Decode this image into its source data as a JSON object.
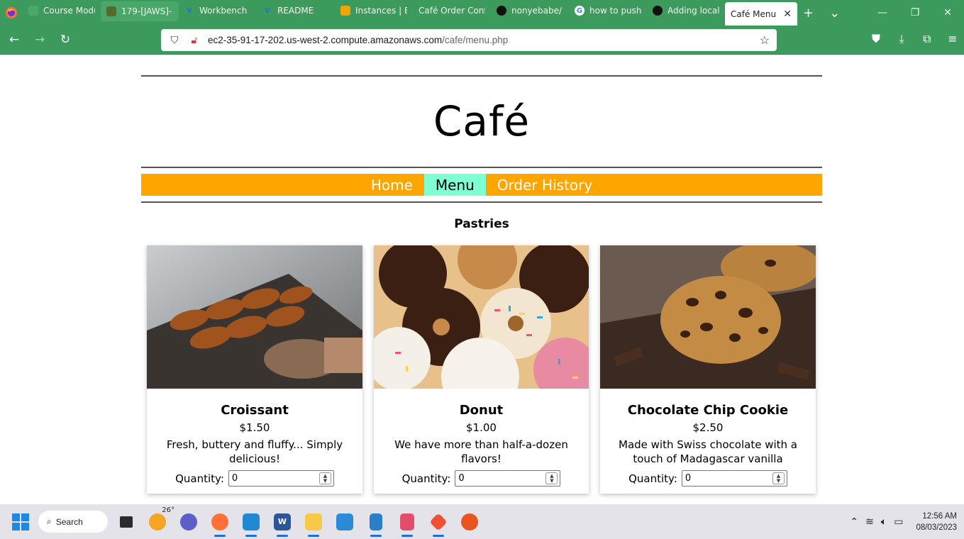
{
  "browser": {
    "tabs": [
      {
        "title": "Course Modules",
        "icon": "canvas-icon",
        "color": "#4aa76a"
      },
      {
        "title": "179-[JAWS]-",
        "icon": "vocareum-icon",
        "color": "#4aa76a"
      },
      {
        "title": "Workbench",
        "icon": "vocareum-v-icon",
        "color": "#2a6ad8"
      },
      {
        "title": "README",
        "icon": "vocareum-v-icon",
        "color": "#2a6ad8"
      },
      {
        "title": "Instances | E",
        "icon": "aws-cube-icon",
        "color": "#f0a500"
      },
      {
        "title": "Café Order Conf",
        "icon": "page-icon",
        "color": "#4aa76a"
      },
      {
        "title": "nonyebabe/",
        "icon": "github-icon",
        "color": "#111"
      },
      {
        "title": "how to push",
        "icon": "google-icon",
        "color": "#fff"
      },
      {
        "title": "Adding local",
        "icon": "github-icon",
        "color": "#111"
      }
    ],
    "active_tab": {
      "title": "Café Menu",
      "close": "✕"
    },
    "url_host": "ec2-35-91-17-202.us-west-2.compute.amazonaws.com",
    "url_path": "/cafe/menu.php"
  },
  "site": {
    "title": "Café",
    "nav": [
      {
        "label": "Home",
        "current": false
      },
      {
        "label": "Menu",
        "current": true
      },
      {
        "label": "Order History",
        "current": false
      }
    ],
    "section_title": "Pastries",
    "quantity_label": "Quantity:",
    "items": [
      {
        "name": "Croissant",
        "price": "$1.50",
        "description": "Fresh, buttery and fluffy... Simply delicious!",
        "quantity": "0"
      },
      {
        "name": "Donut",
        "price": "$1.00",
        "description": "We have more than half-a-dozen flavors!",
        "quantity": "0"
      },
      {
        "name": "Chocolate Chip Cookie",
        "price": "$2.50",
        "description": "Made with Swiss chocolate with a touch of Madagascar vanilla",
        "quantity": "0"
      }
    ],
    "colors": {
      "menubar": "#ffa500",
      "current_nav": "#7fffd4",
      "chrome": "#3c9a5c"
    }
  },
  "taskbar": {
    "search_label": "Search",
    "weather": "26°",
    "time": "12:56 AM",
    "date": "08/03/2023"
  }
}
